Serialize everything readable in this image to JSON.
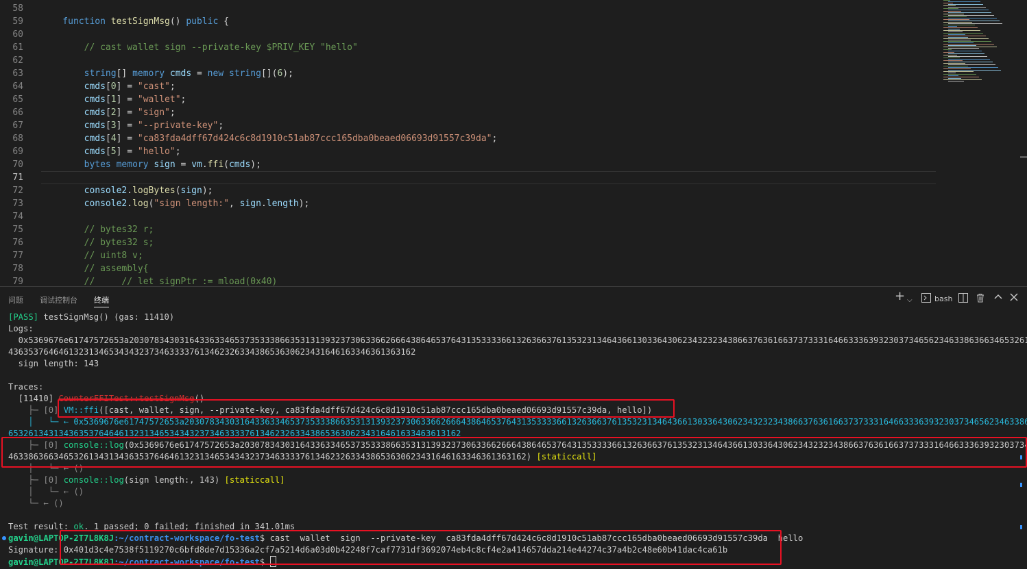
{
  "editor": {
    "line_numbers": [
      "58",
      "59",
      "60",
      "61",
      "62",
      "63",
      "64",
      "65",
      "66",
      "67",
      "68",
      "69",
      "70",
      "71",
      "72",
      "73",
      "74",
      "75",
      "76",
      "77",
      "78",
      "79"
    ],
    "lines": [
      "",
      "    function testSignMsg() public {",
      "",
      "        // cast wallet sign --private-key $PRIV_KEY \"hello\"",
      "",
      "        string[] memory cmds = new string[](6);",
      "        cmds[0] = \"cast\";",
      "        cmds[1] = \"wallet\";",
      "        cmds[2] = \"sign\";",
      "        cmds[3] = \"--private-key\";",
      "        cmds[4] = \"ca83fda4dff67d424c6c8d1910c51ab87ccc165dba0beaed06693d91557c39da\";",
      "        cmds[5] = \"hello\";",
      "        bytes memory sign = vm.ffi(cmds);",
      "",
      "        console2.logBytes(sign);",
      "        console2.log(\"sign length:\", sign.length);",
      "",
      "        // bytes32 r;",
      "        // bytes32 s;",
      "        // uint8 v;",
      "        // assembly{",
      "        //     // let signPtr := mload(0x40)"
    ]
  },
  "panel": {
    "tabs": [
      "问题",
      "调试控制台",
      "终端"
    ],
    "active_tab": "终端",
    "shell_label": "bash"
  },
  "terminal": {
    "pass_tag": "[PASS]",
    "pass_test": " testSignMsg() (gas: 11410)",
    "logs_label": "Logs:",
    "log_bytes_1": "  0x5369676e61747572653a2030783430316433633465373533386635313139323730633662666438646537643135333366132636637613532313464366130336430623432323438663763616637373331646633363932303734656234633863663465326134313",
    "log_bytes_2": "436353764646132313465343432373463333761346232633438653630623431646163346361363162",
    "sign_length": "  sign length: 143",
    "traces_label": "Traces:",
    "trace_gas": "  [11410] ",
    "trace_contract": "CounterFFITest",
    "trace_fn": "::testSignMsg",
    "trace_fn_end": "()",
    "ffi_prefix": "    ├─ [0] ",
    "ffi_vm": "VM",
    "ffi_fn": "::ffi",
    "ffi_args": "([cast, wallet, sign, --private-key, ca83fda4dff67d424c6c8d1910c51ab87ccc165dba0beaed06693d91557c39da, hello])",
    "ffi_ret_1": "    │   └─ ← 0x5369676e61747572653a203078343031643363346537353338663531313932373063366266643864653764313533336613263663761353231346436613033643062343232343866376361663737333164663336393230373465623463386366346263",
    "ffi_ret_2": "653261343134363537646461323134653434323734633337613462326334386536306234316461633463613162",
    "log1_prefix": "    ├─ [0] ",
    "log1_console": "console",
    "log1_fn": "::log",
    "log1_args_1": "(0x5369676e61747572653a203078343031643363346537353338663531313932373063366266643864653764313533336613263663761353231346436613033643062343232343866376361663737333164663336393230373465623",
    "log1_args_2": "4633863663465326134313436353764646132313465343432373463333761346232633438653630623431646163346361363162)",
    "log1_static": "[staticcall]",
    "ret_line_1": "    │   └─ ← ()",
    "log2_prefix": "    ├─ [0] ",
    "log2_console": "console",
    "log2_fn": "::log",
    "log2_args": "(sign length:, 143) ",
    "log2_static": "[staticcall]",
    "ret_line_2": "    │   └─ ← ()",
    "ret_line_3": "    └─ ← ()",
    "result_prefix": "Test result: ",
    "result_ok": "ok",
    "result_rest": ". 1 passed; 0 failed; finished in 341.01ms",
    "prompt_user": "gavin@LAPTOP-2T7L8K8J",
    "prompt_path": ":~/contract-workspace/fo-test",
    "prompt_dollar": "$ ",
    "command": "cast  wallet  sign  --private-key  ca83fda4dff67d424c6c8d1910c51ab87ccc165dba0beaed06693d91557c39da  hello",
    "signature_label": "Signature: ",
    "signature_value": "0x401d3c4e7538f5119270c6bfd8de7d15336a2cf7a5214d6a03d0b42248f7caf7731df3692074eb4c8cf4e2a414657dda214e44274c37a4b2c48e60b41dac4ca61b"
  },
  "colors": {
    "highlight_box": "#e81123",
    "pass": "#23d18b",
    "cyan": "#29b8db",
    "yellow": "#e5e510"
  },
  "icons": [
    "plus-icon",
    "chevron-down-icon",
    "terminal-icon",
    "split-icon",
    "trash-icon",
    "maximize-icon",
    "close-icon"
  ]
}
